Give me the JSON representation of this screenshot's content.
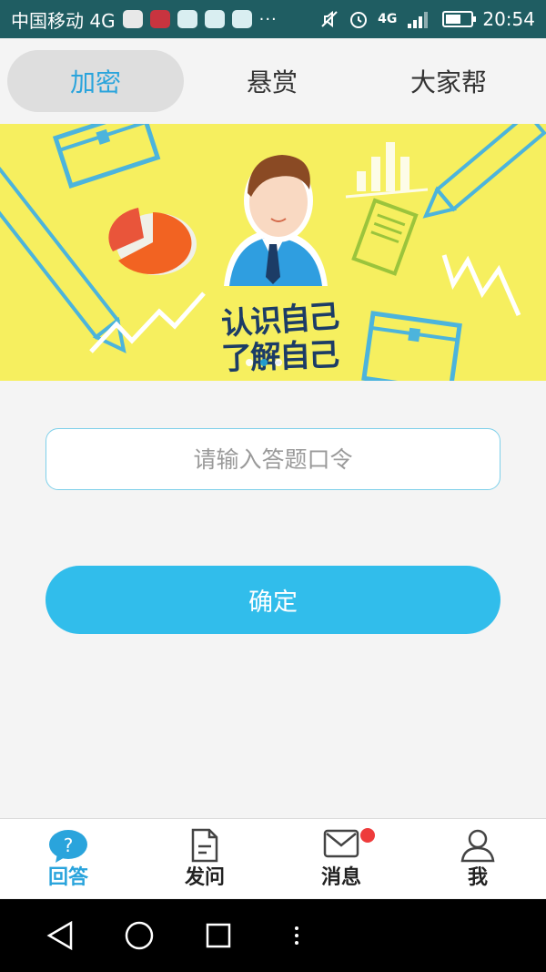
{
  "status_bar": {
    "carrier": "中国移动 4G",
    "icon_names": [
      "app-icon-browser",
      "app-icon-news",
      "app-icon-jq",
      "app-icon-jq",
      "app-icon-jq"
    ],
    "more": "···",
    "network": "4G",
    "time": "20:54",
    "battery_level": 0.6
  },
  "tabs": [
    {
      "label": "加密",
      "active": true
    },
    {
      "label": "悬赏",
      "active": false
    },
    {
      "label": "大家帮",
      "active": false
    }
  ],
  "banner": {
    "line1": "认识自己",
    "line2": "了解自己",
    "slide_count": 3,
    "active_slide": 2
  },
  "form": {
    "placeholder": "请输入答题口令",
    "value": "",
    "confirm_label": "确定"
  },
  "bottom_nav": [
    {
      "label": "回答",
      "icon": "question-icon",
      "active": true
    },
    {
      "label": "发问",
      "icon": "document-icon",
      "active": false
    },
    {
      "label": "消息",
      "icon": "mail-icon",
      "active": false,
      "badge": true
    },
    {
      "label": "我",
      "icon": "user-icon",
      "active": false
    }
  ],
  "colors": {
    "accent": "#2aa4dc",
    "button": "#31bdeb",
    "banner_bg": "#f6ef5f",
    "status_bar": "#1f5d62",
    "badge": "#ee3b3b"
  }
}
